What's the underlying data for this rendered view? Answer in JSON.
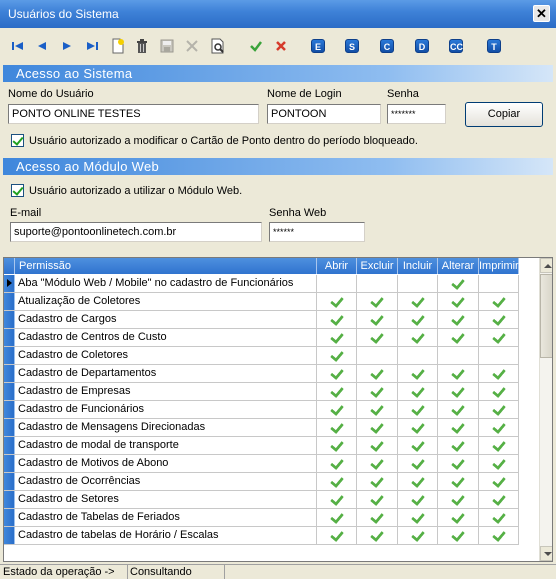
{
  "window": {
    "title": "Usuários do Sistema",
    "close_label": "✕"
  },
  "toolbar": {
    "letters": [
      "E",
      "S",
      "C",
      "D",
      "CC",
      "T"
    ]
  },
  "acesso_sistema": {
    "section_title": "Acesso ao Sistema",
    "nome_usuario_label": "Nome do Usuário",
    "nome_usuario_value": "PONTO ONLINE TESTES",
    "login_label": "Nome de Login",
    "login_value": "PONTOON",
    "senha_label": "Senha",
    "senha_value": "*******",
    "copiar_label": "Copiar",
    "autoriza_cartao_label": "Usuário autorizado a modificar o Cartão de Ponto dentro do período bloqueado."
  },
  "acesso_web": {
    "section_title": "Acesso ao Módulo Web",
    "autoriza_web_label": "Usuário autorizado a utilizar o Módulo Web.",
    "email_label": "E-mail",
    "email_value": "suporte@pontoonlinetech.com.br",
    "senha_web_label": "Senha Web",
    "senha_web_value": "******"
  },
  "grid": {
    "headers": [
      "Permissão",
      "Abrir",
      "Excluir",
      "Incluir",
      "Alterar",
      "Imprimir"
    ],
    "rows": [
      {
        "name": "Aba \"Módulo Web / Mobile\" no cadastro de Funcionários",
        "flags": [
          false,
          false,
          false,
          true,
          false
        ]
      },
      {
        "name": "Atualização de Coletores",
        "flags": [
          true,
          true,
          true,
          true,
          true
        ]
      },
      {
        "name": "Cadastro de Cargos",
        "flags": [
          true,
          true,
          true,
          true,
          true
        ]
      },
      {
        "name": "Cadastro de Centros de Custo",
        "flags": [
          true,
          true,
          true,
          true,
          true
        ]
      },
      {
        "name": "Cadastro de Coletores",
        "flags": [
          true,
          false,
          false,
          false,
          false
        ]
      },
      {
        "name": "Cadastro de Departamentos",
        "flags": [
          true,
          true,
          true,
          true,
          true
        ]
      },
      {
        "name": "Cadastro de Empresas",
        "flags": [
          true,
          true,
          true,
          true,
          true
        ]
      },
      {
        "name": "Cadastro de Funcionários",
        "flags": [
          true,
          true,
          true,
          true,
          true
        ]
      },
      {
        "name": "Cadastro de Mensagens Direcionadas",
        "flags": [
          true,
          true,
          true,
          true,
          true
        ]
      },
      {
        "name": "Cadastro de modal de transporte",
        "flags": [
          true,
          true,
          true,
          true,
          true
        ]
      },
      {
        "name": "Cadastro de Motivos de Abono",
        "flags": [
          true,
          true,
          true,
          true,
          true
        ]
      },
      {
        "name": "Cadastro de Ocorrências",
        "flags": [
          true,
          true,
          true,
          true,
          true
        ]
      },
      {
        "name": "Cadastro de Setores",
        "flags": [
          true,
          true,
          true,
          true,
          true
        ]
      },
      {
        "name": "Cadastro de Tabelas de Feriados",
        "flags": [
          true,
          true,
          true,
          true,
          true
        ]
      },
      {
        "name": "Cadastro de tabelas de Horário / Escalas",
        "flags": [
          true,
          true,
          true,
          true,
          true
        ]
      }
    ]
  },
  "status": {
    "label": "Estado da operação ->",
    "value": "Consultando"
  }
}
